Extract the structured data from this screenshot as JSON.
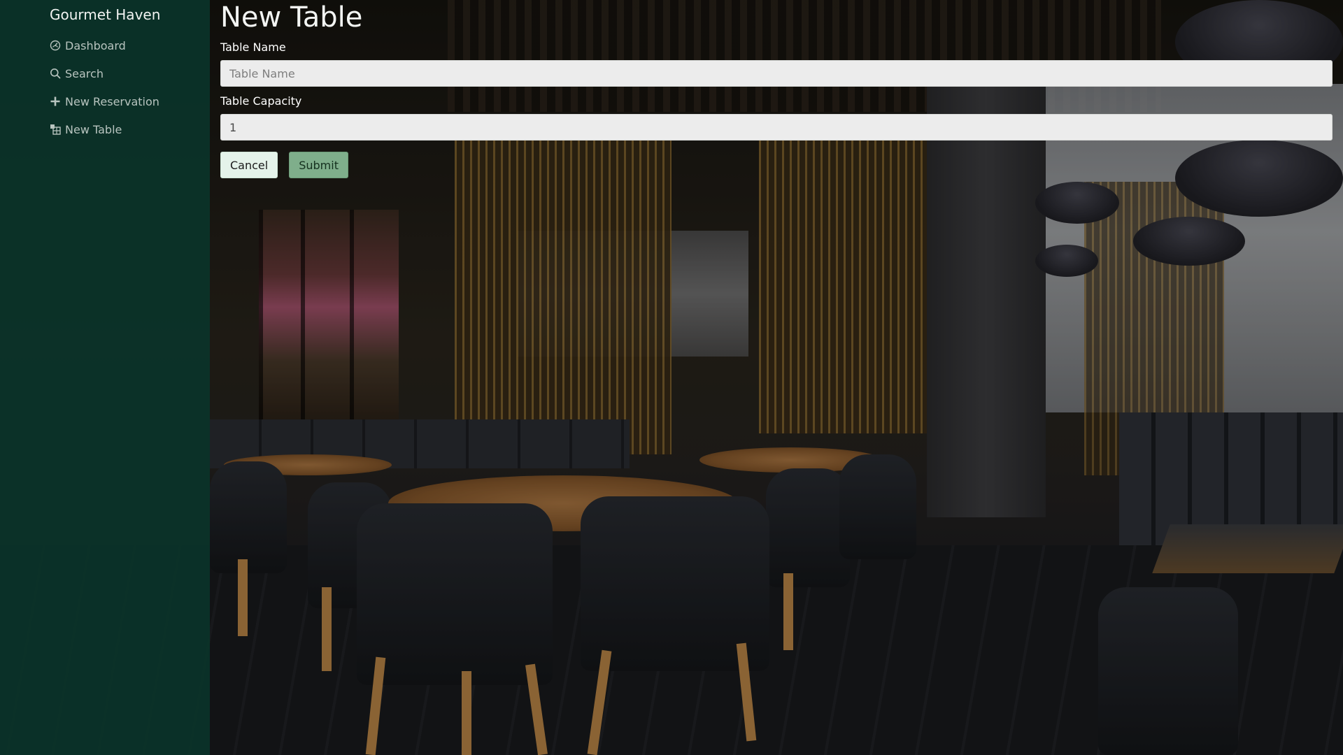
{
  "app": {
    "brand": "Gourmet Haven"
  },
  "sidebar": {
    "items": [
      {
        "label": "Dashboard",
        "icon": "dashboard-icon"
      },
      {
        "label": "Search",
        "icon": "search-icon"
      },
      {
        "label": "New Reservation",
        "icon": "plus-icon"
      },
      {
        "label": "New Table",
        "icon": "table-icon"
      }
    ]
  },
  "form": {
    "title": "New Table",
    "table_name": {
      "label": "Table Name",
      "placeholder": "Table Name",
      "value": ""
    },
    "table_capacity": {
      "label": "Table Capacity",
      "placeholder": "",
      "value": "1"
    },
    "cancel_label": "Cancel",
    "submit_label": "Submit"
  },
  "colors": {
    "sidebar_bg": "#0a342a",
    "cancel_bg": "#e5f3ea",
    "submit_bg": "#7fae8b",
    "input_bg": "#ececec"
  }
}
